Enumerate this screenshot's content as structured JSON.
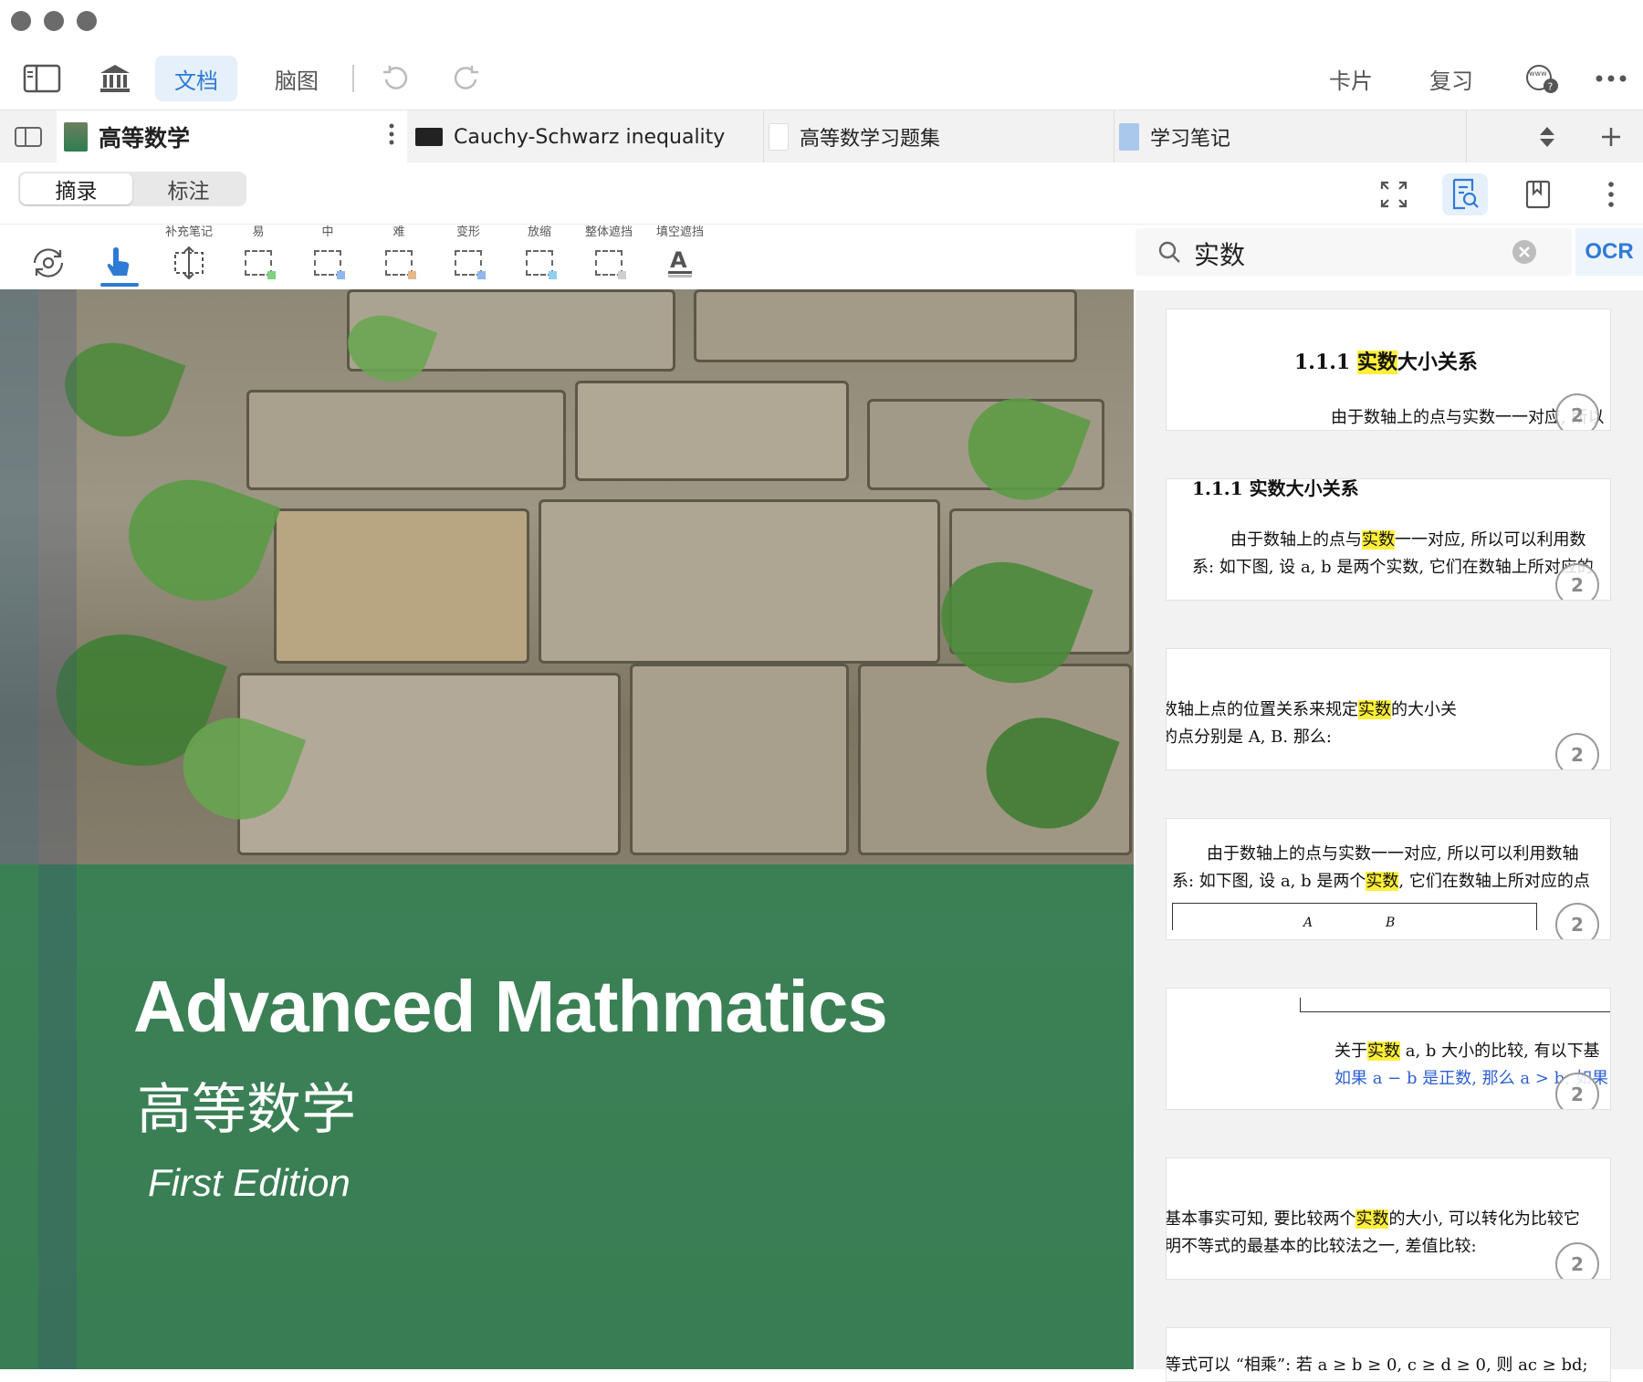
{
  "toolbar": {
    "doc_tab": "文档",
    "mindmap_tab": "脑图",
    "cards": "卡片",
    "review": "复习"
  },
  "tabs": [
    {
      "label": "高等数学",
      "active": true
    },
    {
      "label": "Cauchy-Schwarz inequality",
      "active": false
    },
    {
      "label": "高等数学习题集",
      "active": false
    },
    {
      "label": "学习笔记",
      "active": false
    }
  ],
  "subbar": {
    "excerpt": "摘录",
    "annotation": "标注"
  },
  "tools": {
    "supplement_note": "补充笔记",
    "easy": "易",
    "medium": "中",
    "hard": "难",
    "deform": "变形",
    "zoom": "放缩",
    "mask_all": "整体遮挡",
    "cloze_mask": "填空遮挡"
  },
  "document": {
    "title_en": "Advanced Mathmatics",
    "title_zh": "高等数学",
    "edition": "First Edition"
  },
  "search": {
    "query": "实数",
    "ocr_label": "OCR"
  },
  "results": [
    {
      "page": "2",
      "l1a": "1.1.1  ",
      "l1b": "实数",
      "l1c": "大小关系",
      "l2": "由于数轴上的点与实数一一对应, 所以"
    },
    {
      "page": "2",
      "l0": "1.1.1   实数大小关系",
      "l1a": "由于数轴上的点与",
      "l1b": "实数",
      "l1c": "一一对应, 所以可以利用数",
      "l2": "系: 如下图, 设 a, b 是两个实数, 它们在数轴上所对应的"
    },
    {
      "page": "2",
      "l1a": "数轴上点的位置关系来规定",
      "l1b": "实数",
      "l1c": "的大小关",
      "l2": "的点分别是 A, B. 那么:"
    },
    {
      "page": "2",
      "l1": "由于数轴上的点与实数一一对应, 所以可以利用数轴",
      "l2a": "系: 如下图, 设 a, b 是两个",
      "l2b": "实数",
      "l2c": ", 它们在数轴上所对应的点",
      "l3a": "A",
      "l3b": "B"
    },
    {
      "page": "2",
      "l1a": "关于",
      "l1b": "实数",
      "l1c": " a, b 大小的比较, 有以下基",
      "l2": "如果 a − b 是正数, 那么 a > b; 如果"
    },
    {
      "page": "2",
      "l1a": "基本事实可知, 要比较两个",
      "l1b": "实数",
      "l1c": "的大小, 可以转化为比较它",
      "l2": "明不等式的最基本的比较法之一, 差值比较:"
    },
    {
      "page": "",
      "l1": "等式可以 “相乘”: 若 a ≥ b ≥ 0, c ≥ d ≥ 0, 则 ac ≥ bd;"
    }
  ],
  "colors": {
    "accent": "#2f7ad6",
    "highlight": "#ffef3a",
    "cover_band": "#2e8052"
  }
}
